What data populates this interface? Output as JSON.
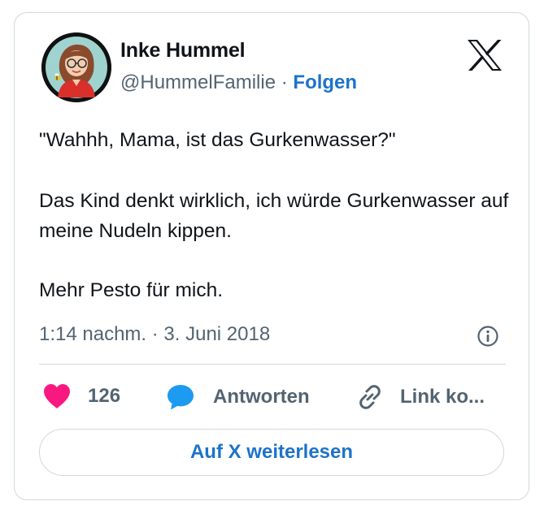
{
  "author": {
    "name": "Inke Hummel",
    "handle": "@HummelFamilie",
    "separator": "·",
    "follow_label": "Folgen"
  },
  "brand_icon": "x-logo-icon",
  "tweet": {
    "paragraphs": [
      "\"Wahhh, Mama, ist das Gurkenwasser?\"",
      "Das Kind denkt wirklich, ich würde Gurkenwasser auf meine Nudeln kippen.",
      "Mehr Pesto für mich."
    ],
    "timestamp": "1:14 nachm. · 3. Juni 2018"
  },
  "actions": {
    "like_count": "126",
    "reply_label": "Antworten",
    "copy_link_label": "Link ko..."
  },
  "read_more_label": "Auf X weiterlesen",
  "colors": {
    "accent": "#1d73c9",
    "like": "#f91880",
    "reply_icon": "#1d9bf0",
    "secondary_text": "#536471",
    "border": "#cfd9de"
  }
}
